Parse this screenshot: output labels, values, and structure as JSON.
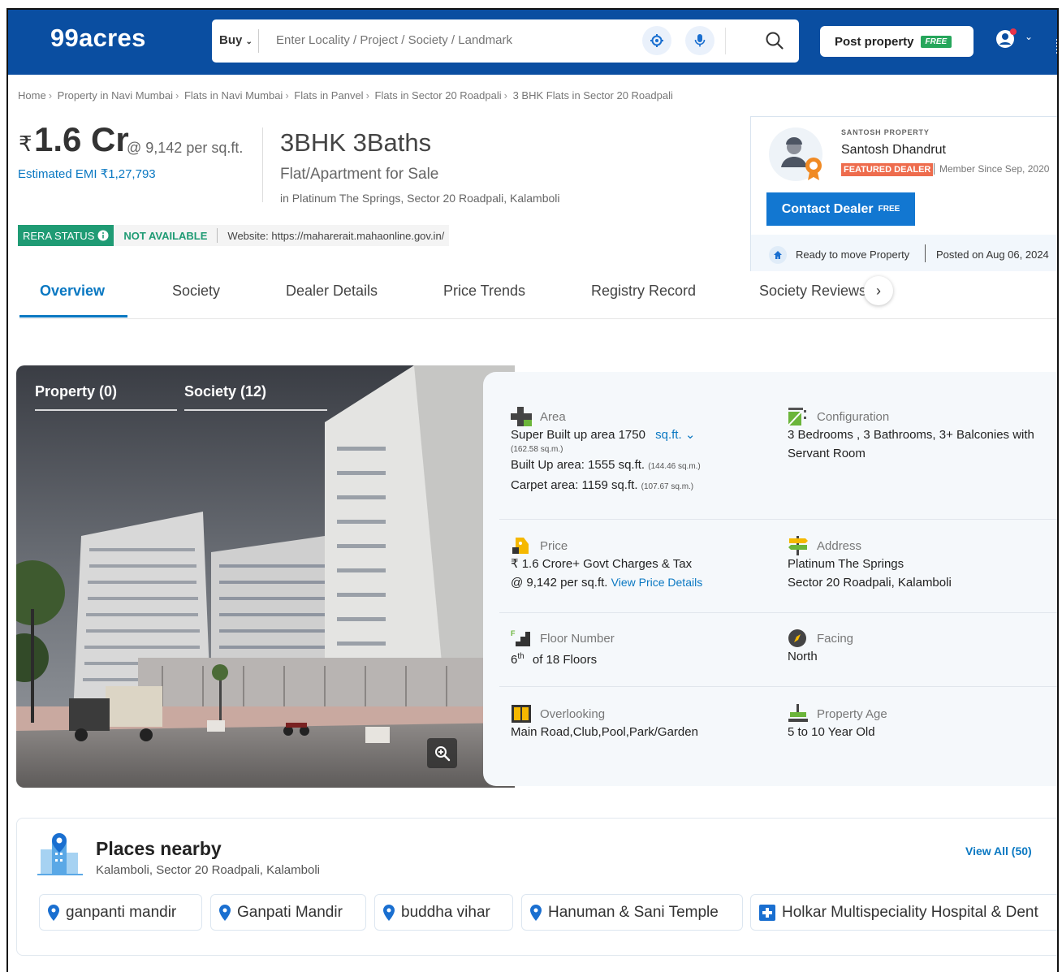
{
  "header": {
    "logo": "99acres",
    "buy_label": "Buy",
    "search_placeholder": "Enter Locality / Project / Society / Landmark",
    "post_property_label": "Post property",
    "post_property_tag": "FREE"
  },
  "breadcrumbs": [
    "Home",
    "Property in Navi Mumbai",
    "Flats in Navi Mumbai",
    "Flats in Panvel",
    "Flats in Sector 20 Roadpali",
    "3 BHK Flats in Sector 20 Roadpali"
  ],
  "listing": {
    "currency": "₹",
    "price": "1.6 Cr",
    "per_sqft": "@ 9,142 per sq.ft.",
    "emi": "Estimated EMI ₹1,27,793",
    "title": "3BHK 3Baths",
    "subtitle": "Flat/Apartment for Sale",
    "location": "in Platinum The Springs, Sector 20 Roadpali, Kalamboli",
    "rera_label": "RERA STATUS",
    "rera_status": "NOT AVAILABLE",
    "rera_website": "Website: https://maharerait.mahaonline.gov.in/"
  },
  "dealer": {
    "label": "SANTOSH PROPERTY",
    "name": "Santosh Dhandrut",
    "badge": "FEATURED DEALER",
    "member_since": "Member Since Sep, 2020",
    "contact_label": "Contact Dealer",
    "contact_tag": "FREE",
    "ready": "Ready to move Property",
    "posted": "Posted on Aug 06, 2024"
  },
  "tabs": [
    "Overview",
    "Society",
    "Dealer Details",
    "Price Trends",
    "Registry Record",
    "Society Reviews"
  ],
  "gallery": {
    "tab_property": "Property (0)",
    "tab_society": "Society (12)"
  },
  "details": {
    "area": {
      "label": "Area",
      "super_built": "Super Built up area 1750",
      "unit": "sq.ft.",
      "super_built_sqm": "(162.58 sq.m.)",
      "built_up": "Built Up area: 1555 sq.ft.",
      "built_up_sqm": "(144.46 sq.m.)",
      "carpet": "Carpet area: 1159 sq.ft.",
      "carpet_sqm": "(107.67 sq.m.)"
    },
    "configuration": {
      "label": "Configuration",
      "value": "3 Bedrooms , 3 Bathrooms, 3+ Balconies with Servant Room"
    },
    "price": {
      "label": "Price",
      "line1": "₹ 1.6 Crore+ Govt Charges & Tax",
      "line2": "@ 9,142 per sq.ft.",
      "link": "View Price Details"
    },
    "address": {
      "label": "Address",
      "line1": "Platinum The Springs",
      "line2": "Sector 20 Roadpali, Kalamboli"
    },
    "floor": {
      "label": "Floor Number",
      "num": "6",
      "sup": "th",
      "rest": "of 18 Floors"
    },
    "facing": {
      "label": "Facing",
      "value": "North"
    },
    "overlooking": {
      "label": "Overlooking",
      "value": "Main Road,Club,Pool,Park/Garden"
    },
    "age": {
      "label": "Property Age",
      "value": "5 to 10 Year Old"
    }
  },
  "places": {
    "title": "Places nearby",
    "subtitle": "Kalamboli, Sector 20 Roadpali, Kalamboli",
    "view_all": "View All (50)",
    "chips": [
      "ganpanti mandir",
      "Ganpati Mandir",
      "buddha vihar",
      "Hanuman & Sani Temple",
      "Holkar Multispeciality Hospital & Dent"
    ]
  },
  "colors": {
    "brand": "#0a4ea1",
    "link": "#0a78c2",
    "rera": "#1f9b74",
    "featured": "#ee6c4d"
  }
}
